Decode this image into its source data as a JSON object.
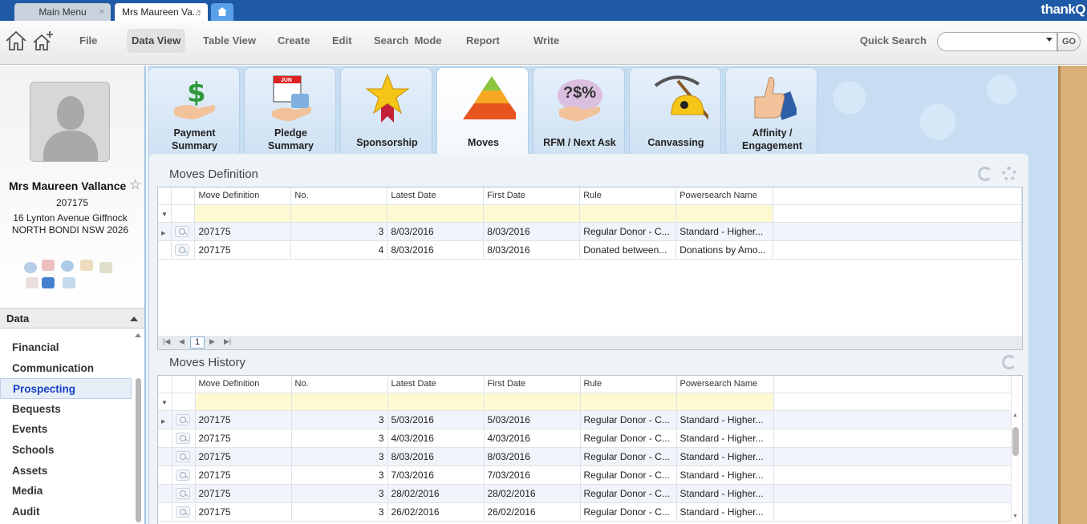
{
  "window": {
    "tabs": [
      {
        "label": "Main Menu",
        "close": "×"
      },
      {
        "label": "Mrs Maureen Va...",
        "close": "×"
      }
    ],
    "brand": "thankQ"
  },
  "toolbar": {
    "menu": [
      "File",
      "Data View",
      "Table View",
      "Create",
      "Edit",
      "Search  Mode",
      "Report",
      "Write"
    ],
    "active": "Data View",
    "quick_search_label": "Quick Search",
    "quick_search_value": "",
    "go_label": "GO"
  },
  "contact": {
    "name": "Mrs Maureen Vallance",
    "id": "207175",
    "address_line1": "16 Lynton Avenue Giffnock",
    "address_line2": "NORTH BONDI NSW 2026",
    "star": "☆"
  },
  "nav": {
    "header": "Data",
    "items": [
      "Financial",
      "Communication",
      "Prospecting",
      "Bequests",
      "Events",
      "Schools",
      "Assets",
      "Media",
      "Audit"
    ],
    "active": "Prospecting"
  },
  "modules": [
    {
      "l1": "Payment",
      "l2": "Summary"
    },
    {
      "l1": "Pledge",
      "l2": "Summary",
      "badge": "JUN"
    },
    {
      "l1": "Sponsorship",
      "l2": ""
    },
    {
      "l1": "Moves",
      "l2": ""
    },
    {
      "l1": "RFM / Next Ask",
      "l2": "",
      "glyph": "?$%"
    },
    {
      "l1": "Canvassing",
      "l2": ""
    },
    {
      "l1": "Affinity /",
      "l2": "Engagement"
    }
  ],
  "active_module": "Moves",
  "moves_definition": {
    "title": "Moves Definition",
    "columns": [
      "Move Definition",
      "No.",
      "Latest Date",
      "First Date",
      "Rule",
      "Powersearch Name"
    ],
    "rows": [
      [
        "207175",
        "3",
        "8/03/2016",
        "8/03/2016",
        "Regular Donor - C...",
        "Standard - Higher..."
      ],
      [
        "207175",
        "4",
        "8/03/2016",
        "8/03/2016",
        "Donated between...",
        "Donations by Amo..."
      ]
    ],
    "page": "1"
  },
  "moves_history": {
    "title": "Moves History",
    "columns": [
      "Move Definition",
      "No.",
      "Latest Date",
      "First Date",
      "Rule",
      "Powersearch Name"
    ],
    "rows": [
      [
        "207175",
        "3",
        "5/03/2016",
        "5/03/2016",
        "Regular Donor - C...",
        "Standard - Higher..."
      ],
      [
        "207175",
        "3",
        "4/03/2016",
        "4/03/2016",
        "Regular Donor - C...",
        "Standard - Higher..."
      ],
      [
        "207175",
        "3",
        "8/03/2016",
        "8/03/2016",
        "Regular Donor - C...",
        "Standard - Higher..."
      ],
      [
        "207175",
        "3",
        "7/03/2016",
        "7/03/2016",
        "Regular Donor - C...",
        "Standard - Higher..."
      ],
      [
        "207175",
        "3",
        "28/02/2016",
        "28/02/2016",
        "Regular Donor - C...",
        "Standard - Higher..."
      ],
      [
        "207175",
        "3",
        "26/02/2016",
        "26/02/2016",
        "Regular Donor - C...",
        "Standard - Higher..."
      ]
    ]
  }
}
